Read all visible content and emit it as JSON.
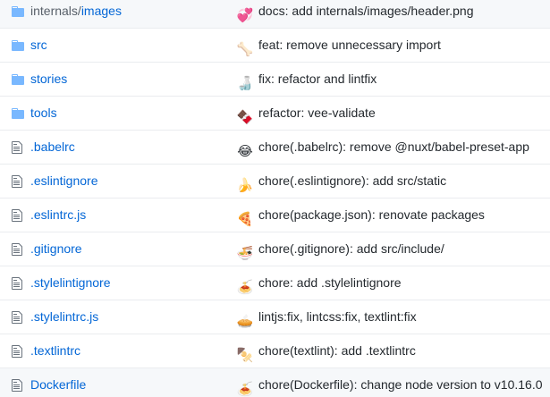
{
  "colors": {
    "link": "#0366d6",
    "folder_icon": "#79b8ff",
    "file_icon": "#6a737d",
    "text": "#24292e",
    "border": "#eaecef"
  },
  "rows": [
    {
      "type": "folder",
      "prefix": "internals/",
      "name": "images",
      "emoji": "💞",
      "emoji_name": "revolving-hearts-icon",
      "message": "docs: add internals/images/header.png"
    },
    {
      "type": "folder",
      "prefix": "",
      "name": "src",
      "emoji": "🦴",
      "emoji_name": "bone-icon",
      "message": "feat: remove unnecessary import"
    },
    {
      "type": "folder",
      "prefix": "",
      "name": "stories",
      "emoji": "🍶",
      "emoji_name": "sake-icon",
      "message": "fix: refactor and lintfix"
    },
    {
      "type": "folder",
      "prefix": "",
      "name": "tools",
      "emoji": "🍫",
      "emoji_name": "chocolate-bar-icon",
      "message": "refactor: vee-validate"
    },
    {
      "type": "file",
      "prefix": "",
      "name": ".babelrc",
      "emoji": "😂",
      "emoji_name": "joy-icon",
      "message": "chore(.babelrc): remove @nuxt/babel-preset-app"
    },
    {
      "type": "file",
      "prefix": "",
      "name": ".eslintignore",
      "emoji": "🍌",
      "emoji_name": "banana-icon",
      "message": "chore(.eslintignore): add src/static"
    },
    {
      "type": "file",
      "prefix": "",
      "name": ".eslintrc.js",
      "emoji": "🍕",
      "emoji_name": "pizza-icon",
      "message": "chore(package.json): renovate packages"
    },
    {
      "type": "file",
      "prefix": "",
      "name": ".gitignore",
      "emoji": "🍜",
      "emoji_name": "ramen-icon",
      "message": "chore(.gitignore): add src/include/"
    },
    {
      "type": "file",
      "prefix": "",
      "name": ".stylelintignore",
      "emoji": "🍝",
      "emoji_name": "spaghetti-icon",
      "message": "chore: add .stylelintignore"
    },
    {
      "type": "file",
      "prefix": "",
      "name": ".stylelintrc.js",
      "emoji": "🥧",
      "emoji_name": "pie-icon",
      "message": "lintjs:fix, lintcss:fix, textlint:fix"
    },
    {
      "type": "file",
      "prefix": "",
      "name": ".textlintrc",
      "emoji": "🍢",
      "emoji_name": "oden-icon",
      "message": "chore(textlint): add .textlintrc"
    },
    {
      "type": "file",
      "prefix": "",
      "name": "Dockerfile",
      "emoji": "🍝",
      "emoji_name": "spaghetti-icon",
      "message": "chore(Dockerfile): change node version to v10.16.0"
    }
  ]
}
